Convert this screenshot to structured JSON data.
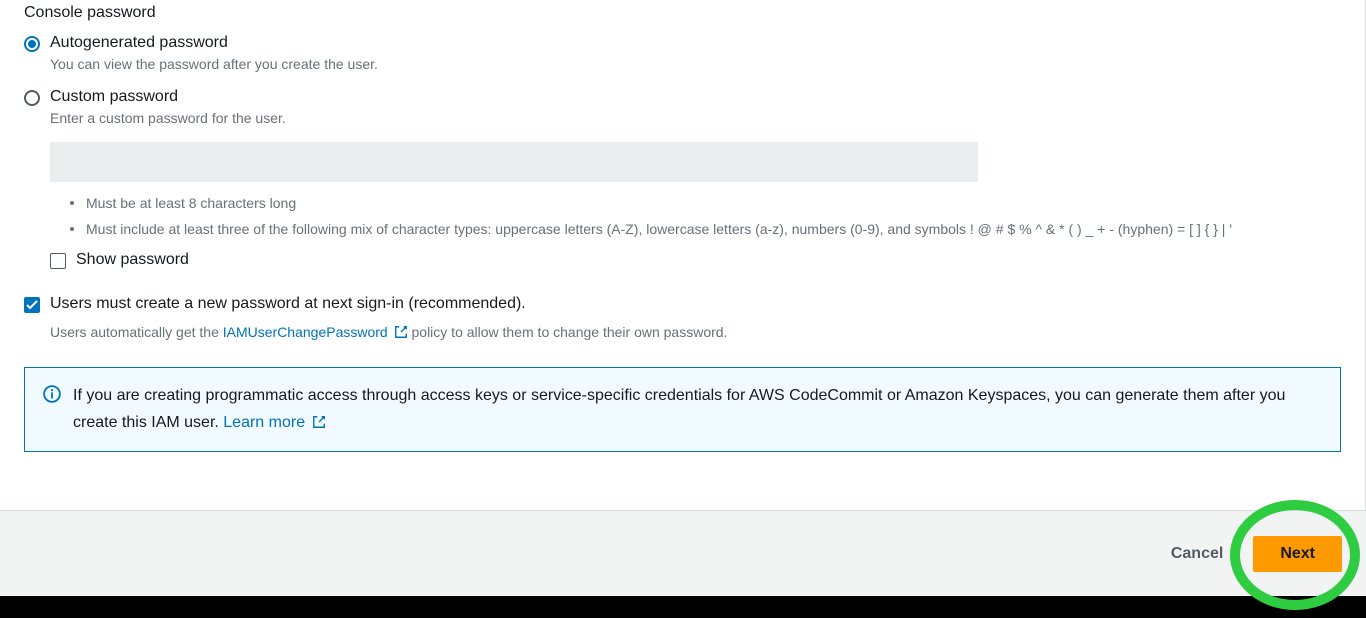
{
  "section": {
    "title": "Console password"
  },
  "options": {
    "auto": {
      "label": "Autogenerated password",
      "desc": "You can view the password after you create the user."
    },
    "custom": {
      "label": "Custom password",
      "desc": "Enter a custom password for the user."
    }
  },
  "requirements": {
    "r1": "Must be at least 8 characters long",
    "r2": "Must include at least three of the following mix of character types: uppercase letters (A-Z), lowercase letters (a-z), numbers (0-9), and symbols ! @ # $ % ^ & * ( ) _ + - (hyphen) = [ ] { } | '"
  },
  "show_password": {
    "label": "Show password"
  },
  "must_reset": {
    "label": "Users must create a new password at next sign-in (recommended).",
    "desc_before": "Users automatically get the ",
    "policy_link": "IAMUserChangePassword",
    "desc_after": " policy to allow them to change their own password."
  },
  "info": {
    "text_before": "If you are creating programmatic access through access keys or service-specific credentials for AWS CodeCommit or Amazon Keyspaces, you can generate them after you create this IAM user. ",
    "learn_more": "Learn more"
  },
  "buttons": {
    "cancel": "Cancel",
    "next": "Next"
  }
}
